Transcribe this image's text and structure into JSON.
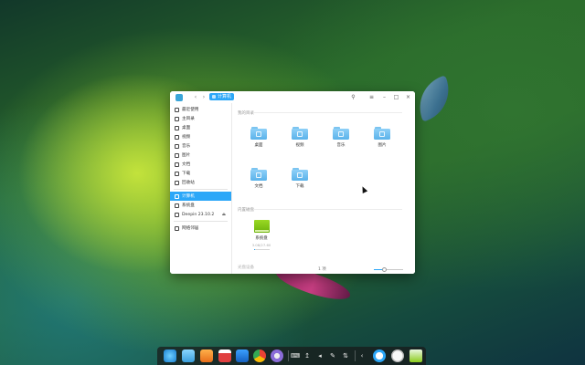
{
  "window": {
    "breadcrumb": "计算机",
    "status": "1 项"
  },
  "sidebar": {
    "items": [
      {
        "label": "最近使用",
        "icon": "clock-icon"
      },
      {
        "label": "主目录",
        "icon": "home-icon"
      },
      {
        "label": "桌面",
        "icon": "desktop-icon"
      },
      {
        "label": "视频",
        "icon": "video-icon"
      },
      {
        "label": "音乐",
        "icon": "music-icon"
      },
      {
        "label": "图片",
        "icon": "picture-icon"
      },
      {
        "label": "文档",
        "icon": "document-icon"
      },
      {
        "label": "下载",
        "icon": "download-icon"
      },
      {
        "label": "回收站",
        "icon": "trash-icon"
      },
      {
        "label": "计算机",
        "icon": "computer-icon",
        "active": true
      },
      {
        "label": "系统盘",
        "icon": "disk-icon"
      },
      {
        "label": "Deepin 23.10.2",
        "icon": "mount-icon"
      },
      {
        "label": "网络邻居",
        "icon": "network-icon"
      }
    ]
  },
  "main": {
    "sections": {
      "my_dirs": "我的目录",
      "disks": "内置磁盘",
      "third": "光盘设备"
    },
    "folders": [
      {
        "label": "桌面",
        "icon": "desktop-folder-icon"
      },
      {
        "label": "视频",
        "icon": "video-folder-icon"
      },
      {
        "label": "音乐",
        "icon": "music-folder-icon"
      },
      {
        "label": "图片",
        "icon": "picture-folder-icon"
      },
      {
        "label": "文档",
        "icon": "document-folder-icon"
      },
      {
        "label": "下载",
        "icon": "download-folder-icon"
      }
    ],
    "disk": {
      "name": "系统盘",
      "usage": "3.08/27.60",
      "fill_fraction": 0.11
    }
  },
  "statusbar": {
    "zoom_fraction": 0.35
  },
  "dock": {
    "apps": [
      "launcher-icon",
      "file-manager-icon",
      "app-store-icon",
      "calendar-icon",
      "music-player-icon",
      "browser-icon",
      "settings-icon"
    ],
    "tray": [
      "keyboard-icon",
      "usb-icon",
      "volume-icon",
      "edit-icon",
      "network-tray-icon",
      "chevron-left-icon"
    ],
    "right": [
      "power-icon",
      "user-avatar-icon",
      "trash-dock-icon"
    ]
  },
  "colors": {
    "accent": "#2ca7f8",
    "folder": "#6cc0f2",
    "disk": "#8ccc1c"
  }
}
